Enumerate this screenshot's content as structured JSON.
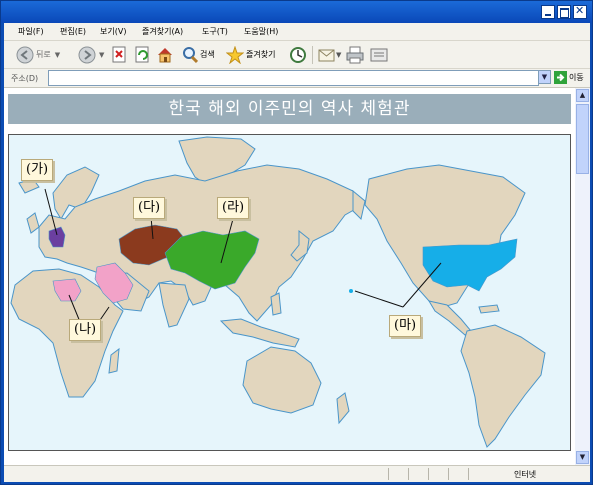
{
  "menu": {
    "items": [
      "파일(F)",
      "편집(E)",
      "보기(V)",
      "즐겨찾기(A)",
      "도구(T)",
      "도움말(H)"
    ]
  },
  "toolbar": {
    "back_label": "뒤로",
    "search_label": "검색",
    "favorites_label": "즐겨찾기"
  },
  "address": {
    "label": "주소(D)",
    "value": "",
    "go_label": "이동"
  },
  "page": {
    "title": "한국 해외 이주민의 역사 체험관",
    "labels": {
      "ga": "(가)",
      "na": "(나)",
      "da": "(다)",
      "ra": "(라)",
      "ma": "(마)"
    }
  },
  "status": {
    "zone": "인터넷"
  },
  "colors": {
    "ocean": "#e6f5fb",
    "land": "#e2d6be",
    "ga_region": "#6b3fa0",
    "na_region": "#f2a2c8",
    "da_region": "#8b3a1e",
    "ra_region": "#3aa92a",
    "ma_region": "#16aee8"
  }
}
